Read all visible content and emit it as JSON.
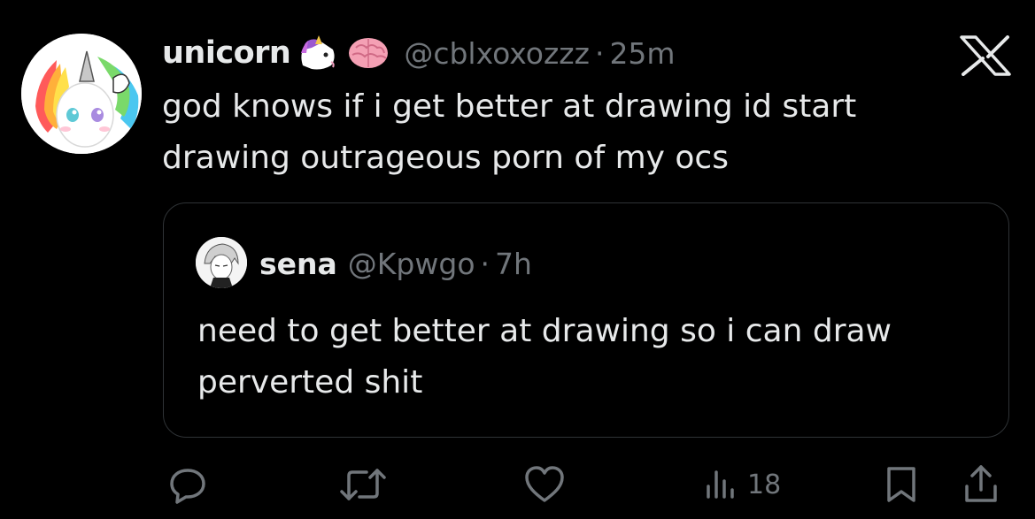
{
  "tweet": {
    "display_name": "unicorn",
    "emojis": [
      "unicorn-icon",
      "brain-icon"
    ],
    "handle": "@cblxoxozzz",
    "separator": "·",
    "time": "25m",
    "text": "god knows if i get better at drawing id start drawing outrageous porn of my ocs"
  },
  "quote": {
    "display_name": "sena",
    "handle": "@Kpwgo",
    "separator": "·",
    "time": "7h",
    "text": "need to get better at drawing so i can draw perverted shit"
  },
  "actions": {
    "reply_icon": "reply-icon",
    "retweet_icon": "retweet-icon",
    "like_icon": "heart-icon",
    "views_icon": "views-icon",
    "views_count": "18",
    "bookmark_icon": "bookmark-icon",
    "share_icon": "share-icon"
  },
  "colors": {
    "background": "#000000",
    "text_primary": "#e7e9ea",
    "text_secondary": "#71767b",
    "border": "#2f3336"
  },
  "app_logo": "x-logo"
}
